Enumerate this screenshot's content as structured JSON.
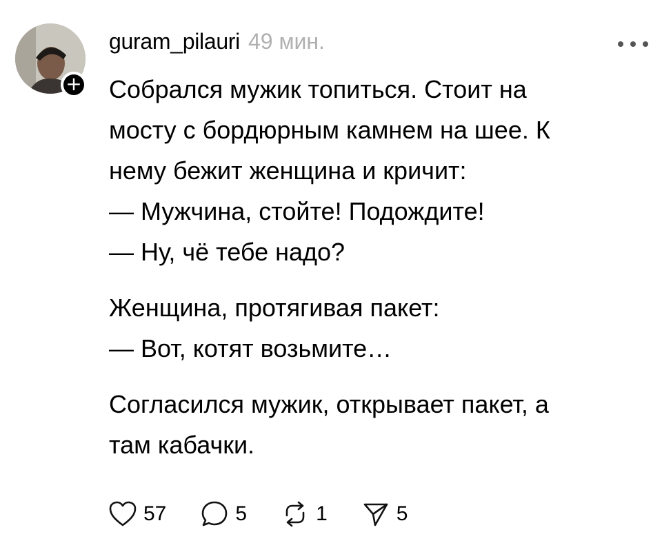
{
  "post": {
    "author": "guram_pilauri",
    "time": "49 мин.",
    "paragraphs": [
      [
        "Собрался мужик топиться. Стоит на",
        "мосту с бордюрным камнем на шее. К",
        "нему бежит женщина и кричит:",
        "— Мужчина, стойте! Подождите!",
        "— Ну, чё тебе надо?"
      ],
      [
        "Женщина, протягивая пакет:",
        "— Вот, котят возьмите…"
      ],
      [
        "Согласился мужик, открывает пакет, а",
        "там кабачки."
      ]
    ]
  },
  "actions": {
    "likes": "57",
    "comments": "5",
    "reposts": "1",
    "shares": "5"
  },
  "icons": {
    "like": "heart-icon",
    "comment": "comment-bubble-icon",
    "repost": "repost-icon",
    "share": "send-icon",
    "more": "more-dots-icon",
    "follow": "plus-icon"
  }
}
